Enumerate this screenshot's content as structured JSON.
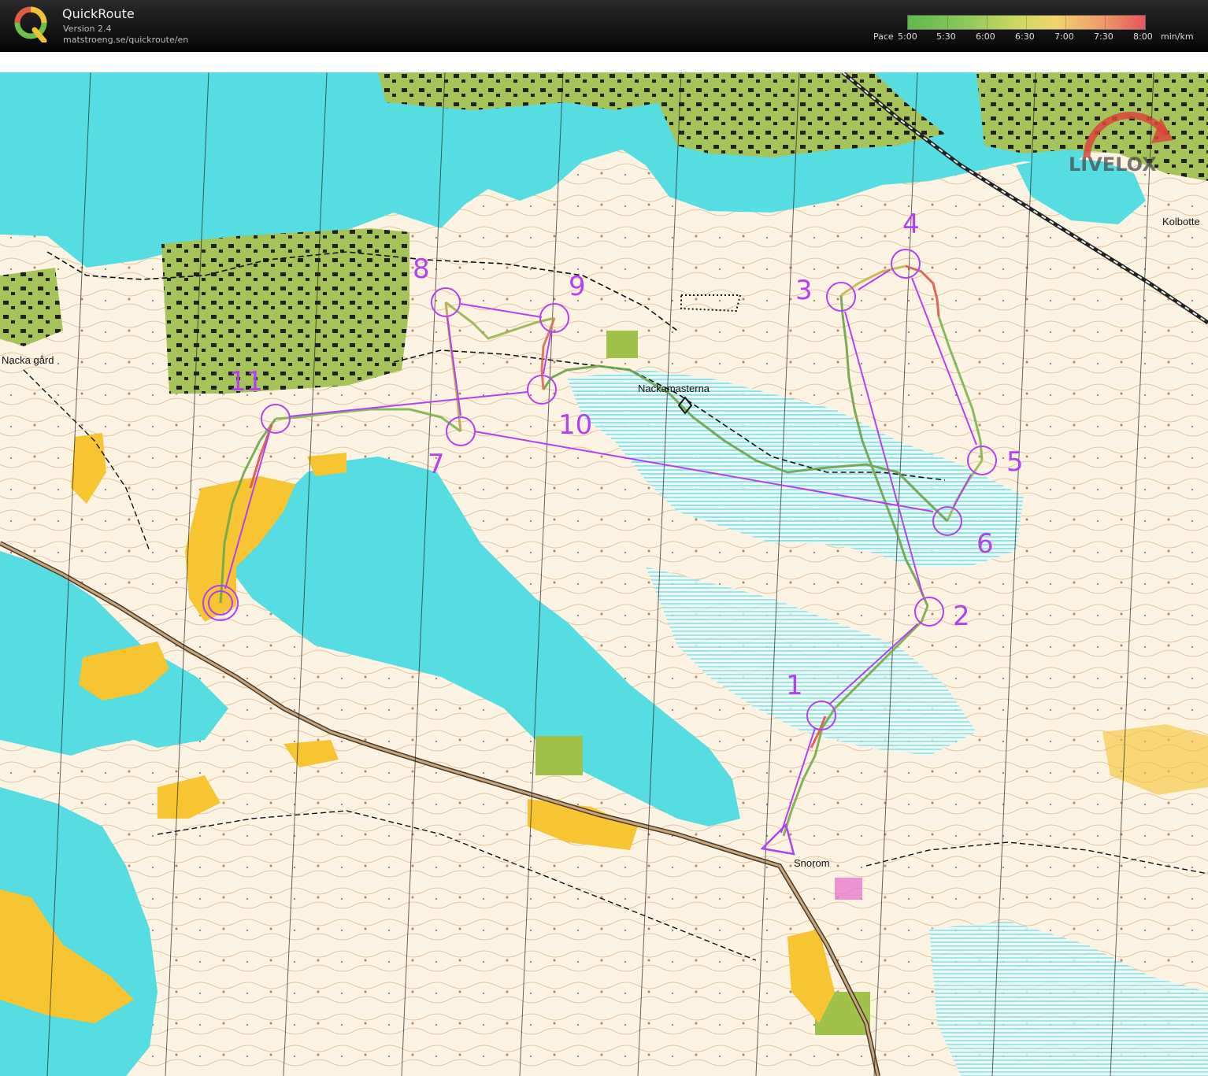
{
  "app": {
    "title": "QuickRoute",
    "version": "Version 2.4",
    "url": "matstroeng.se/quickroute/en"
  },
  "pace_scale": {
    "prefix": "Pace",
    "labels": [
      "5:00",
      "5:30",
      "6:00",
      "6:30",
      "7:00",
      "7:30",
      "8:00"
    ],
    "unit": "min/km",
    "colors": [
      "#5fb84b",
      "#8fc95a",
      "#cbd85c",
      "#f0d66a",
      "#f19a6b",
      "#e5555a"
    ]
  },
  "watermark": {
    "brand": "LIVELOX"
  },
  "map": {
    "place_names": [
      "Nackamasterna",
      "Snorom",
      "Kolbotte",
      "Nacka gård"
    ],
    "controls": [
      "1",
      "2",
      "3",
      "4",
      "5",
      "6",
      "7",
      "8",
      "9",
      "10",
      "11"
    ],
    "colors": {
      "water": "#56dde2",
      "terrain": "#fdf3e3",
      "open_land": "#f7c531",
      "green": "#a1c24a",
      "course": "#b142ee",
      "contour": "#c07a32",
      "marsh": "#76d9dc"
    }
  }
}
